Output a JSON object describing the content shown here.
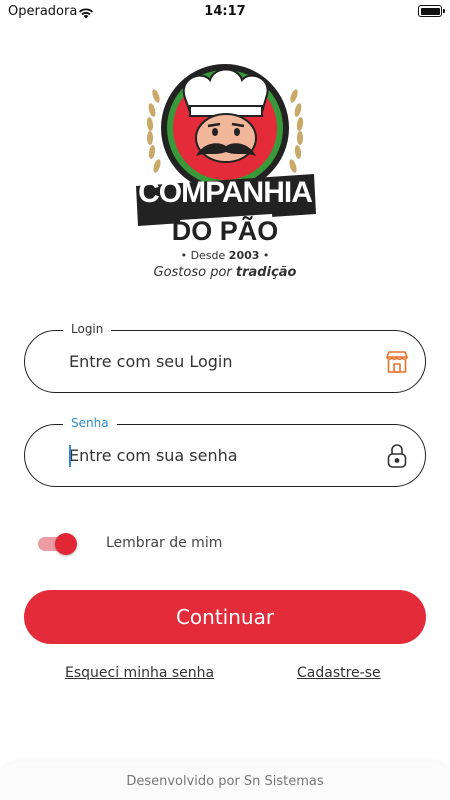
{
  "status_bar": {
    "carrier": "Operadora",
    "time": "14:17",
    "wifi_icon": "wifi-icon",
    "battery_icon": "battery-full-icon"
  },
  "logo": {
    "line1": "COMPANHIA",
    "line2": "DO PÃO",
    "since_prefix": "• Desde",
    "since_year": "2003",
    "since_suffix": "•",
    "tagline_prefix": "Gostoso por",
    "tagline_emphasis": "tradição"
  },
  "form": {
    "login": {
      "label": "Login",
      "placeholder": "Entre com seu Login",
      "icon": "storefront-icon"
    },
    "password": {
      "label": "Senha",
      "placeholder": "Entre com sua senha",
      "icon": "lock-icon"
    },
    "remember_me": {
      "label": "Lembrar de mim",
      "checked": true
    },
    "continue_label": "Continuar"
  },
  "links": {
    "forgot_password": "Esqueci minha senha",
    "register": "Cadastre-se"
  },
  "footer": {
    "text": "Desenvolvido por Sn Sistemas"
  },
  "colors": {
    "primary": "#e32b3a",
    "focus": "#2e8bd0",
    "icon_orange": "#e8702a",
    "logo_green": "#3a9a3a",
    "logo_dark": "#222222",
    "wheat": "#c9a96a"
  }
}
